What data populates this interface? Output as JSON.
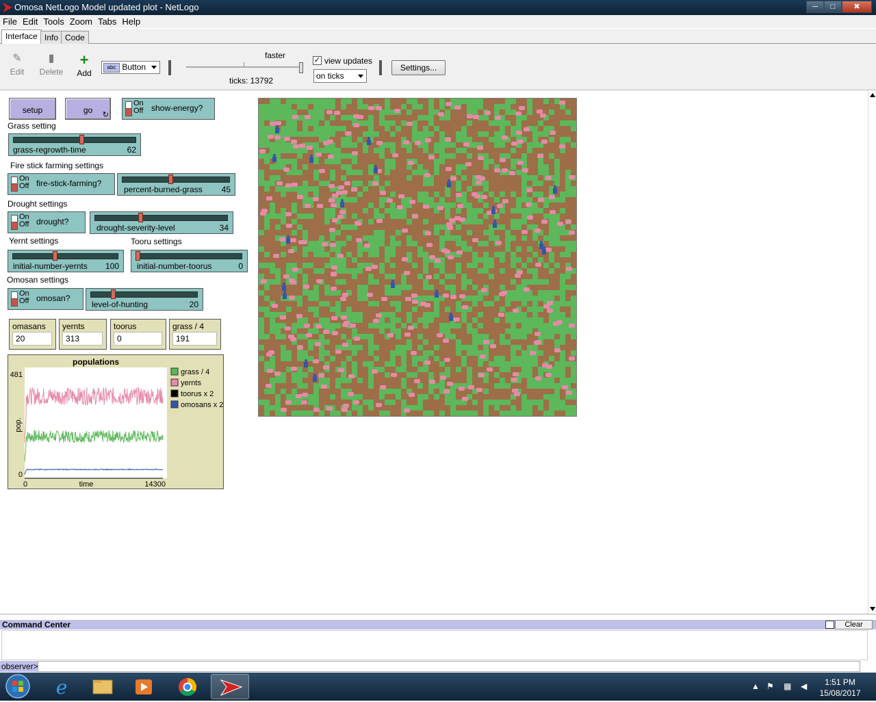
{
  "window": {
    "title": "Omosa NetLogo Model updated plot - NetLogo",
    "min": "─",
    "max": "□",
    "close": "✖"
  },
  "menu": [
    "File",
    "Edit",
    "Tools",
    "Zoom",
    "Tabs",
    "Help"
  ],
  "tabs": [
    "Interface",
    "Info",
    "Code"
  ],
  "toolbar": {
    "edit": "Edit",
    "delete": "Delete",
    "add": "Add",
    "widget_type": "Button",
    "widget_abc": "abc",
    "speed_label": "faster",
    "ticks": "ticks: 13792",
    "view_updates": "view updates",
    "view_updates_checked": "✓",
    "update_mode": "on ticks",
    "settings": "Settings..."
  },
  "buttons": {
    "setup": "setup",
    "go": "go",
    "go_forever": "↻"
  },
  "switch_on": "On",
  "switch_off": "Off",
  "switches": {
    "show_energy": "show-energy?",
    "fire_stick": "fire-stick-farming?",
    "drought": "drought?",
    "omosan": "omosan?"
  },
  "notes": {
    "grass": "Grass setting",
    "fire": "Fire stick farming settings",
    "drought": "Drought settings",
    "yernt": "Yernt settings",
    "tooru": "Tooru settings",
    "omosan": "Omosan settings"
  },
  "sliders": {
    "grass_regrowth": {
      "name": "grass-regrowth-time",
      "value": "62",
      "pos": 0.56
    },
    "percent_burned": {
      "name": "percent-burned-grass",
      "value": "45",
      "pos": 0.45
    },
    "drought_severity": {
      "name": "drought-severity-level",
      "value": "34",
      "pos": 0.34
    },
    "init_yernts": {
      "name": "initial-number-yernts",
      "value": "100",
      "pos": 0.4
    },
    "init_toorus": {
      "name": "initial-number-toorus",
      "value": "0",
      "pos": 0.0
    },
    "hunting": {
      "name": "level-of-hunting",
      "value": "20",
      "pos": 0.2
    }
  },
  "monitors": [
    {
      "label": "omasans",
      "value": "20"
    },
    {
      "label": "yernts",
      "value": "313"
    },
    {
      "label": "toorus",
      "value": "0"
    },
    {
      "label": "grass / 4",
      "value": "191"
    }
  ],
  "colors": {
    "grass": "#5cb85a",
    "dirt": "#9d6e48",
    "yernt": "#e68aa8",
    "omosan": "#3456a8",
    "tooru": "#000000"
  },
  "chart_data": {
    "type": "line",
    "title": "populations",
    "xlabel": "time",
    "ylabel": "pop.",
    "xlim": [
      0,
      14300
    ],
    "ylim": [
      0,
      481
    ],
    "x_tick_labels": [
      "0",
      "14300"
    ],
    "y_tick_labels": [
      "0",
      "481"
    ],
    "legend_position": "right",
    "series": [
      {
        "name": "grass / 4",
        "color": "#5cb85a",
        "mean": 191,
        "amplitude": 28
      },
      {
        "name": "yernts",
        "color": "#e68aa8",
        "mean": 375,
        "amplitude": 40
      },
      {
        "name": "toorus x 2",
        "color": "#000000",
        "mean": 0,
        "amplitude": 0
      },
      {
        "name": "omosans x 2",
        "color": "#3456a8",
        "mean": 40,
        "amplitude": 2
      }
    ]
  },
  "command_center": {
    "title": "Command Center",
    "clear": "Clear",
    "prompt": "observer>"
  },
  "taskbar": {
    "time": "1:51 PM",
    "date": "15/08/2017"
  }
}
